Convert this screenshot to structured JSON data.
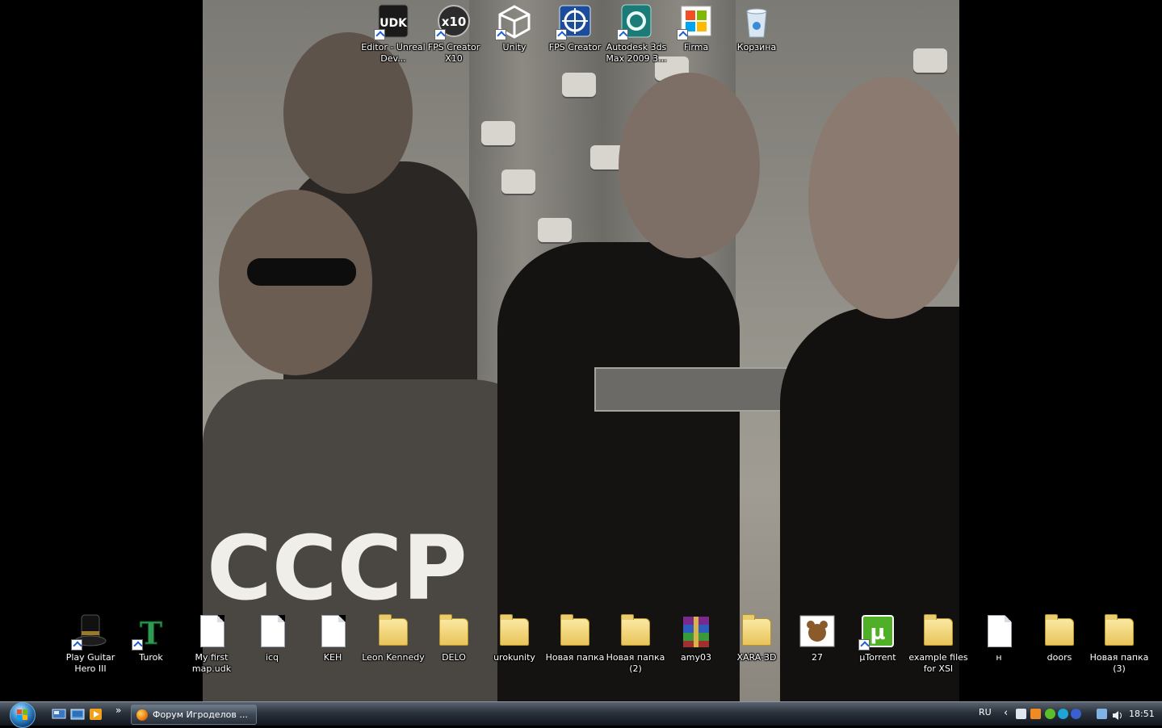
{
  "desktop": {
    "top_icons": [
      {
        "label": "Editor - Unreal Dev...",
        "name": "udk-editor-shortcut",
        "icon": "udk-icon",
        "shortcut": true
      },
      {
        "label": "FPS Creator X10",
        "name": "fps-creator-x10-shortcut",
        "icon": "x10-icon",
        "shortcut": true
      },
      {
        "label": "Unity",
        "name": "unity-shortcut",
        "icon": "unity-icon",
        "shortcut": true
      },
      {
        "label": "FPS Creator",
        "name": "fps-creator-shortcut",
        "icon": "crosshair-icon",
        "shortcut": true
      },
      {
        "label": "Autodesk 3ds Max 2009 3...",
        "name": "3dsmax-shortcut",
        "icon": "3dsmax-icon",
        "shortcut": true
      },
      {
        "label": "Firma",
        "name": "firma-shortcut",
        "icon": "windows-flag-icon",
        "shortcut": true
      },
      {
        "label": "Корзина",
        "name": "recycle-bin",
        "icon": "recycle-bin-icon",
        "shortcut": false
      }
    ],
    "bottom_icons": [
      {
        "label": "Play Guitar Hero III",
        "name": "guitar-hero-shortcut",
        "icon": "top-hat-icon",
        "shortcut": true
      },
      {
        "label": "Turok",
        "name": "turok-shortcut",
        "icon": "turok-icon",
        "shortcut": true
      },
      {
        "label": "My first map.udk",
        "name": "my-first-map-file",
        "icon": "file-icon",
        "shortcut": false
      },
      {
        "label": "icq",
        "name": "icq-file",
        "icon": "text-file-icon",
        "shortcut": false
      },
      {
        "label": "KEH",
        "name": "keh-file",
        "icon": "text-file-icon",
        "shortcut": false
      },
      {
        "label": "Leon Kennedy",
        "name": "leon-kennedy-folder",
        "icon": "folder-icon",
        "shortcut": false
      },
      {
        "label": "DELO",
        "name": "delo-folder",
        "icon": "folder-icon",
        "shortcut": false
      },
      {
        "label": "urokunity",
        "name": "urokunity-folder",
        "icon": "folder-icon",
        "shortcut": false
      },
      {
        "label": "Новая папка",
        "name": "new-folder-1",
        "icon": "folder-icon",
        "shortcut": false
      },
      {
        "label": "Новая папка (2)",
        "name": "new-folder-2",
        "icon": "folder-icon",
        "shortcut": false
      },
      {
        "label": "amy03",
        "name": "amy03-archive",
        "icon": "winrar-icon",
        "shortcut": false
      },
      {
        "label": "XARA-3D",
        "name": "xara-3d-folder",
        "icon": "folder-icon",
        "shortcut": false
      },
      {
        "label": "27",
        "name": "image-27",
        "icon": "bear-image-icon",
        "shortcut": false
      },
      {
        "label": "µTorrent",
        "name": "utorrent-shortcut",
        "icon": "utorrent-icon",
        "shortcut": true
      },
      {
        "label": "example files for XSI",
        "name": "xsi-examples-folder",
        "icon": "folder-icon",
        "shortcut": false
      },
      {
        "label": "н",
        "name": "n-file",
        "icon": "text-file-icon",
        "shortcut": false
      },
      {
        "label": "doors",
        "name": "doors-folder",
        "icon": "folder-icon",
        "shortcut": false
      },
      {
        "label": "Новая папка (3)",
        "name": "new-folder-3",
        "icon": "folder-icon",
        "shortcut": false
      }
    ],
    "wallpaper_text": "CCCP"
  },
  "taskbar": {
    "quick_launch": [
      "show-desktop-icon",
      "switch-windows-icon",
      "media-player-icon"
    ],
    "overflow": "»",
    "window_button": "Форум Игроделов ...",
    "language": "RU",
    "tray_chevron": "‹",
    "clock": "18:51"
  },
  "colors": {
    "taskbar": "#1e252e",
    "label_text": "#ffffff",
    "folder": "#f0d27a"
  }
}
